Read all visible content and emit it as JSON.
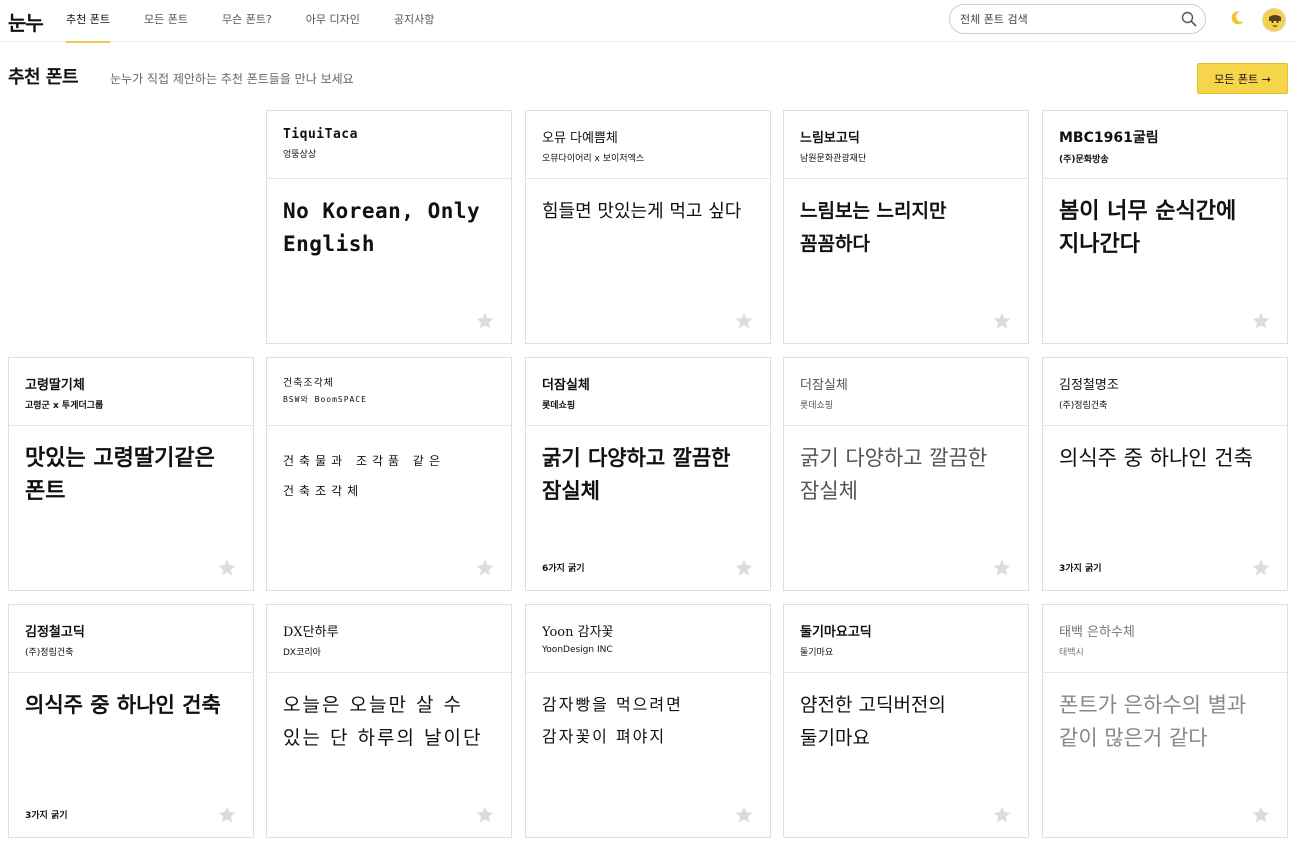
{
  "app": {
    "logo": "눈누"
  },
  "nav": {
    "items": [
      {
        "label": "추천 폰트",
        "active": true
      },
      {
        "label": "모든 폰트",
        "active": false
      },
      {
        "label": "무슨 폰트?",
        "active": false
      },
      {
        "label": "아무 디자인",
        "active": false
      },
      {
        "label": "공지사항",
        "active": false
      }
    ]
  },
  "search": {
    "placeholder": "전체 폰트 검색"
  },
  "icons": {
    "search": "search-icon",
    "theme": "moon-icon",
    "avatar": "avatar",
    "favorite": "star-icon"
  },
  "colors": {
    "accent": "#f7d54a",
    "star": "#dcdcdc",
    "border": "#dedede"
  },
  "page": {
    "title": "추천 폰트",
    "subtitle": "눈누가 직접 제안하는 추천 폰트들을 만나 보세요",
    "all_fonts_button": "모든 폰트 →"
  },
  "cards": [
    {
      "name": "TiquiTaca",
      "maker": "엉뚱상상",
      "sample": "No Korean, Only English",
      "weights": ""
    },
    {
      "name": "오뮤 다예쁨체",
      "maker": "오뮤다이어리 x 보이저엑스",
      "sample": "힘들면 맛있는게 먹고 싶다",
      "weights": ""
    },
    {
      "name": "느림보고딕",
      "maker": "남원문화관광재단",
      "sample": "느림보는 느리지만 꼼꼼하다",
      "weights": ""
    },
    {
      "name": "MBC1961굴림",
      "maker": "(주)문화방송",
      "sample": "봄이 너무 순식간에 지나간다",
      "weights": ""
    },
    {
      "name": "고령딸기체",
      "maker": "고령군 x 투게더그룹",
      "sample": "맛있는 고령딸기같은 폰트",
      "weights": ""
    },
    {
      "name": "건축조각체",
      "maker": "BSW와 BoomSPACE",
      "sample": "건축물과 조각품 같은 건축조각체",
      "weights": ""
    },
    {
      "name": "더잠실체",
      "maker": "롯데쇼핑",
      "sample": "굵기 다양하고 깔끔한 잠실체",
      "weights": "6가지 굵기"
    },
    {
      "name": "더잠실체",
      "maker": "롯데쇼핑",
      "sample": "굵기 다양하고 깔끔한 잠실체",
      "weights": ""
    },
    {
      "name": "김정철명조",
      "maker": "(주)정림건축",
      "sample": "의식주 중 하나인 건축",
      "weights": "3가지 굵기"
    },
    {
      "name": "김정철고딕",
      "maker": "(주)정림건축",
      "sample": "의식주 중 하나인 건축",
      "weights": "3가지 굵기"
    },
    {
      "name": "DX단하루",
      "maker": "DX코리아",
      "sample": "오늘은 오늘만 살 수 있는 단 하루의 날이단",
      "weights": ""
    },
    {
      "name": "Yoon 감자꽃",
      "maker": "YoonDesign INC",
      "sample": "감자빵을 먹으려면 감자꽃이 펴야지",
      "weights": ""
    },
    {
      "name": "둘기마요고딕",
      "maker": "둘기마요",
      "sample": "얌전한 고딕버전의 둘기마요",
      "weights": ""
    },
    {
      "name": "태백 은하수체",
      "maker": "태백시",
      "sample": "폰트가 은하수의 별과 같이 많은거 같다",
      "weights": ""
    }
  ]
}
